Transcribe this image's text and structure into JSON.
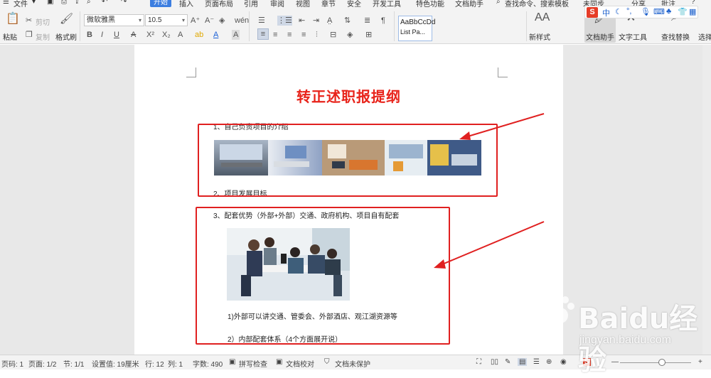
{
  "menubar": {
    "file_label": "文件",
    "tabs": [
      "开始",
      "插入",
      "页面布局",
      "引用",
      "审阅",
      "视图",
      "章节",
      "安全",
      "开发工具",
      "特色功能",
      "文档助手"
    ],
    "search": "查找命令、搜索模板",
    "sync": "未同步",
    "share": "分享",
    "comment": "批注",
    "help": "?"
  },
  "ribbon": {
    "paste": "粘贴",
    "cut": "剪切",
    "copy": "复制",
    "format_painter": "格式刷",
    "font": "微软雅黑",
    "size": "10.5",
    "style_preview": "AaBbCcDd",
    "style_name": "List Pa...",
    "new_style": "新样式",
    "doc_assistant": "文档助手",
    "text_tools": "文字工具",
    "find_replace": "查找替换",
    "select": "选择",
    "bold": "B",
    "italic": "I",
    "underline": "U"
  },
  "ime": {
    "logo": "S",
    "mode": "中"
  },
  "document": {
    "title": "转正述职报提纲",
    "item1": "1、自己负责项目的介绍",
    "item2": "2、项目发展目标",
    "item3": "3、配套优势（外部+外部）交通、政府机构、项目自有配套",
    "sub1": "1)外部可以讲交通、管委会、外部酒店、观江湖资源等",
    "sub2": "2）内部配套体系（4个方面展开说）"
  },
  "statusbar": {
    "page_code": "页码: 1",
    "page": "页面: 1/2",
    "section": "节: 1/1",
    "setting": "设置值: 19厘米",
    "row": "行: 12",
    "col": "列: 1",
    "words": "字数: 490",
    "spell": "拼写检查",
    "proof": "文档校对",
    "protect": "文档未保护"
  },
  "watermark": {
    "brand": "Baidu经验",
    "url": "jingyan.baidu.com"
  },
  "colors": {
    "title": "#e8231a",
    "annotation": "#e02020",
    "active_tab": "#3c7ee0"
  }
}
